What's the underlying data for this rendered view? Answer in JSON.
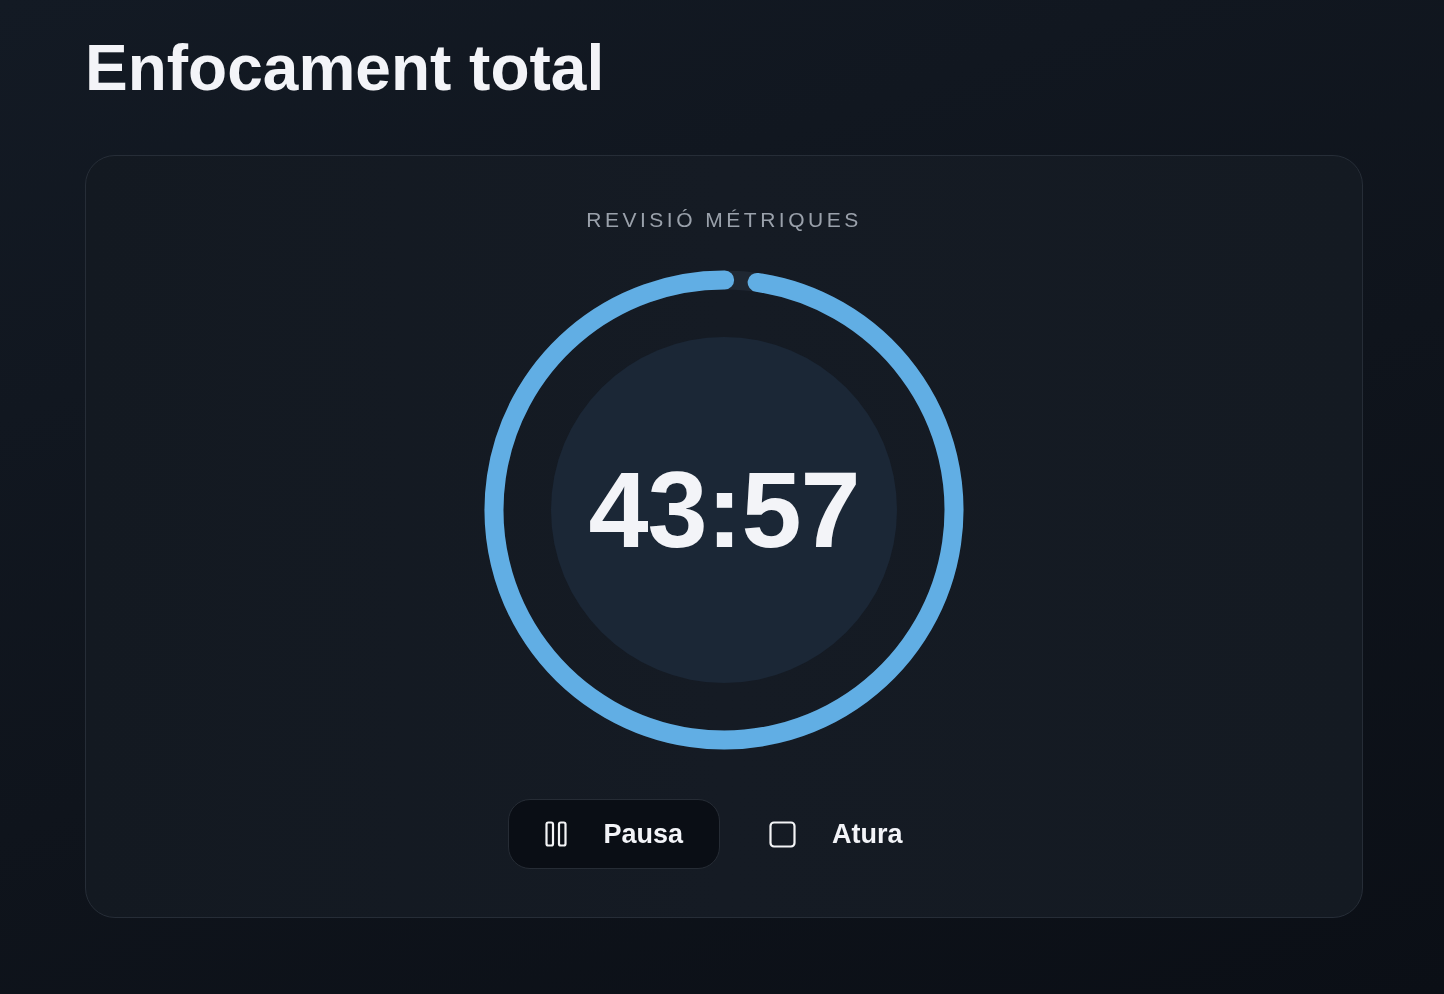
{
  "page": {
    "title": "Enfocament total"
  },
  "timer": {
    "label": "REVISIÓ MÉTRIQUES",
    "time": "43:57",
    "level": 0.977
  },
  "controls": [
    {
      "kind": "pause",
      "label": "Pausa",
      "selected": true
    },
    {
      "kind": "stop",
      "label": "Atura",
      "selected": false
    }
  ]
}
